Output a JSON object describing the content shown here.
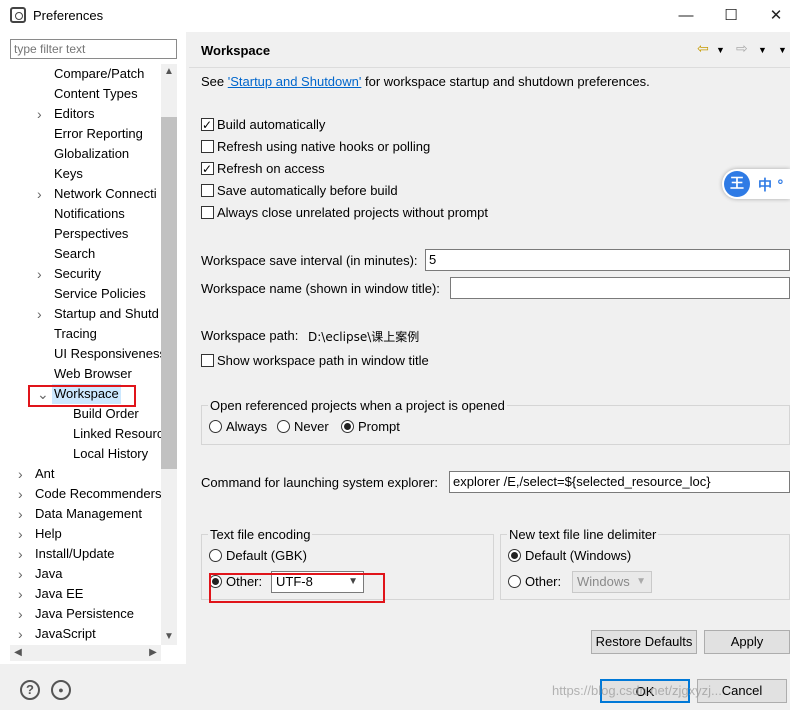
{
  "window": {
    "title": "Preferences",
    "minimize": "—",
    "maximize": "☐",
    "close": "✕"
  },
  "left": {
    "filter_placeholder": "type filter text",
    "tree": [
      {
        "label": "Compare/Patch",
        "arrow": ""
      },
      {
        "label": "Content Types",
        "arrow": ""
      },
      {
        "label": "Editors",
        "arrow": ">"
      },
      {
        "label": "Error Reporting",
        "arrow": ""
      },
      {
        "label": "Globalization",
        "arrow": ""
      },
      {
        "label": "Keys",
        "arrow": ""
      },
      {
        "label": "Network Connecti",
        "arrow": ">"
      },
      {
        "label": "Notifications",
        "arrow": ""
      },
      {
        "label": "Perspectives",
        "arrow": ""
      },
      {
        "label": "Search",
        "arrow": ""
      },
      {
        "label": "Security",
        "arrow": ">"
      },
      {
        "label": "Service Policies",
        "arrow": ""
      },
      {
        "label": "Startup and Shutd",
        "arrow": ">"
      },
      {
        "label": "Tracing",
        "arrow": ""
      },
      {
        "label": "UI Responsiveness",
        "arrow": ""
      },
      {
        "label": "Web Browser",
        "arrow": ""
      },
      {
        "label": "Workspace",
        "arrow": "v"
      },
      {
        "label": "Build Order",
        "arrow": ""
      },
      {
        "label": "Linked Resourc",
        "arrow": ""
      },
      {
        "label": "Local History",
        "arrow": ""
      },
      {
        "label": "Ant",
        "arrow": ">"
      },
      {
        "label": "Code Recommenders",
        "arrow": ">"
      },
      {
        "label": "Data Management",
        "arrow": ">"
      },
      {
        "label": "Help",
        "arrow": ">"
      },
      {
        "label": "Install/Update",
        "arrow": ">"
      },
      {
        "label": "Java",
        "arrow": ">"
      },
      {
        "label": "Java EE",
        "arrow": ">"
      },
      {
        "label": "Java Persistence",
        "arrow": ">"
      },
      {
        "label": "JavaScript",
        "arrow": ">"
      }
    ],
    "selected": "Workspace"
  },
  "page": {
    "title": "Workspace",
    "see_prefix": "See ",
    "see_link": "'Startup and Shutdown'",
    "see_suffix": " for workspace startup and shutdown preferences.",
    "checks": [
      {
        "label": "Build automatically",
        "checked": true
      },
      {
        "label": "Refresh using native hooks or polling",
        "checked": false
      },
      {
        "label": "Refresh on access",
        "checked": true
      },
      {
        "label": "Save automatically before build",
        "checked": false
      },
      {
        "label": "Always close unrelated projects without prompt",
        "checked": false
      }
    ],
    "save_interval_label": "Workspace save interval (in minutes):",
    "save_interval_value": "5",
    "name_label": "Workspace name (shown in window title):",
    "name_value": "",
    "path_label": "Workspace path:",
    "path_value": "D:\\eclipse\\课上案例",
    "show_path_label": "Show workspace path in window title",
    "open_ref_title": "Open referenced projects when a project is opened",
    "open_ref_options": [
      "Always",
      "Never",
      "Prompt"
    ],
    "open_ref_selected": "Prompt",
    "explorer_label": "Command for launching system explorer:",
    "explorer_value": "explorer /E,/select=${selected_resource_loc}",
    "encoding_title": "Text file encoding",
    "encoding_default": "Default (GBK)",
    "encoding_other": "Other:",
    "encoding_value": "UTF-8",
    "delimiter_title": "New text file line delimiter",
    "delimiter_default": "Default (Windows)",
    "delimiter_other": "Other:",
    "delimiter_value": "Windows",
    "restore_defaults": "Restore Defaults",
    "apply": "Apply"
  },
  "footer": {
    "help_icon": "?",
    "ok": "OK",
    "cancel": "Cancel",
    "watermark": "https://blog.csdn.net/zjgxyzj..."
  },
  "ime": {
    "logo": "王",
    "text": "中 °"
  },
  "colors": {
    "link": "#0066cc",
    "highlight_red": "#e0141a",
    "selection": "#cce8ff",
    "ime_blue": "#2f7be5"
  }
}
